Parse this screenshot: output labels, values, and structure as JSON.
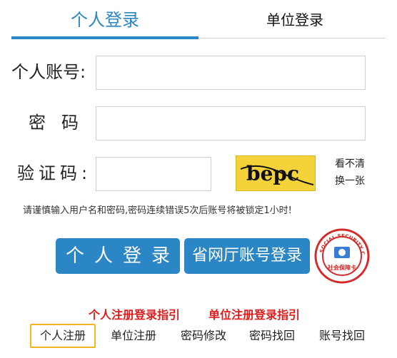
{
  "tabs": {
    "personal": "个人登录",
    "unit": "单位登录"
  },
  "form": {
    "account_label": "个人账号:",
    "account_value": "",
    "password_label": "密码:",
    "password_value": "",
    "captcha_label": "验证码:",
    "captcha_value": "",
    "captcha_text": "bepc",
    "captcha_refresh_line1": "看不清",
    "captcha_refresh_line2": "换一张"
  },
  "notice": "请谨慎输入用户名和密码,密码连续错误5次后账号将被锁定1小时!",
  "buttons": {
    "login": "个人登录",
    "portal": "省网厅账号登录"
  },
  "logo": {
    "text": "SOCIAL SECURITY CARD",
    "chinese": "社会保障卡"
  },
  "guides": {
    "personal": "个人注册登录指引",
    "unit": "单位注册登录指引"
  },
  "bottom_links": [
    "个人注册",
    "单位注册",
    "密码修改",
    "密码找回",
    "账号找回"
  ],
  "colors": {
    "accent": "#2b86c5",
    "guide_red": "#e21b1b",
    "highlight_border": "#f2b625",
    "captcha_bg": "#f4d23a"
  }
}
